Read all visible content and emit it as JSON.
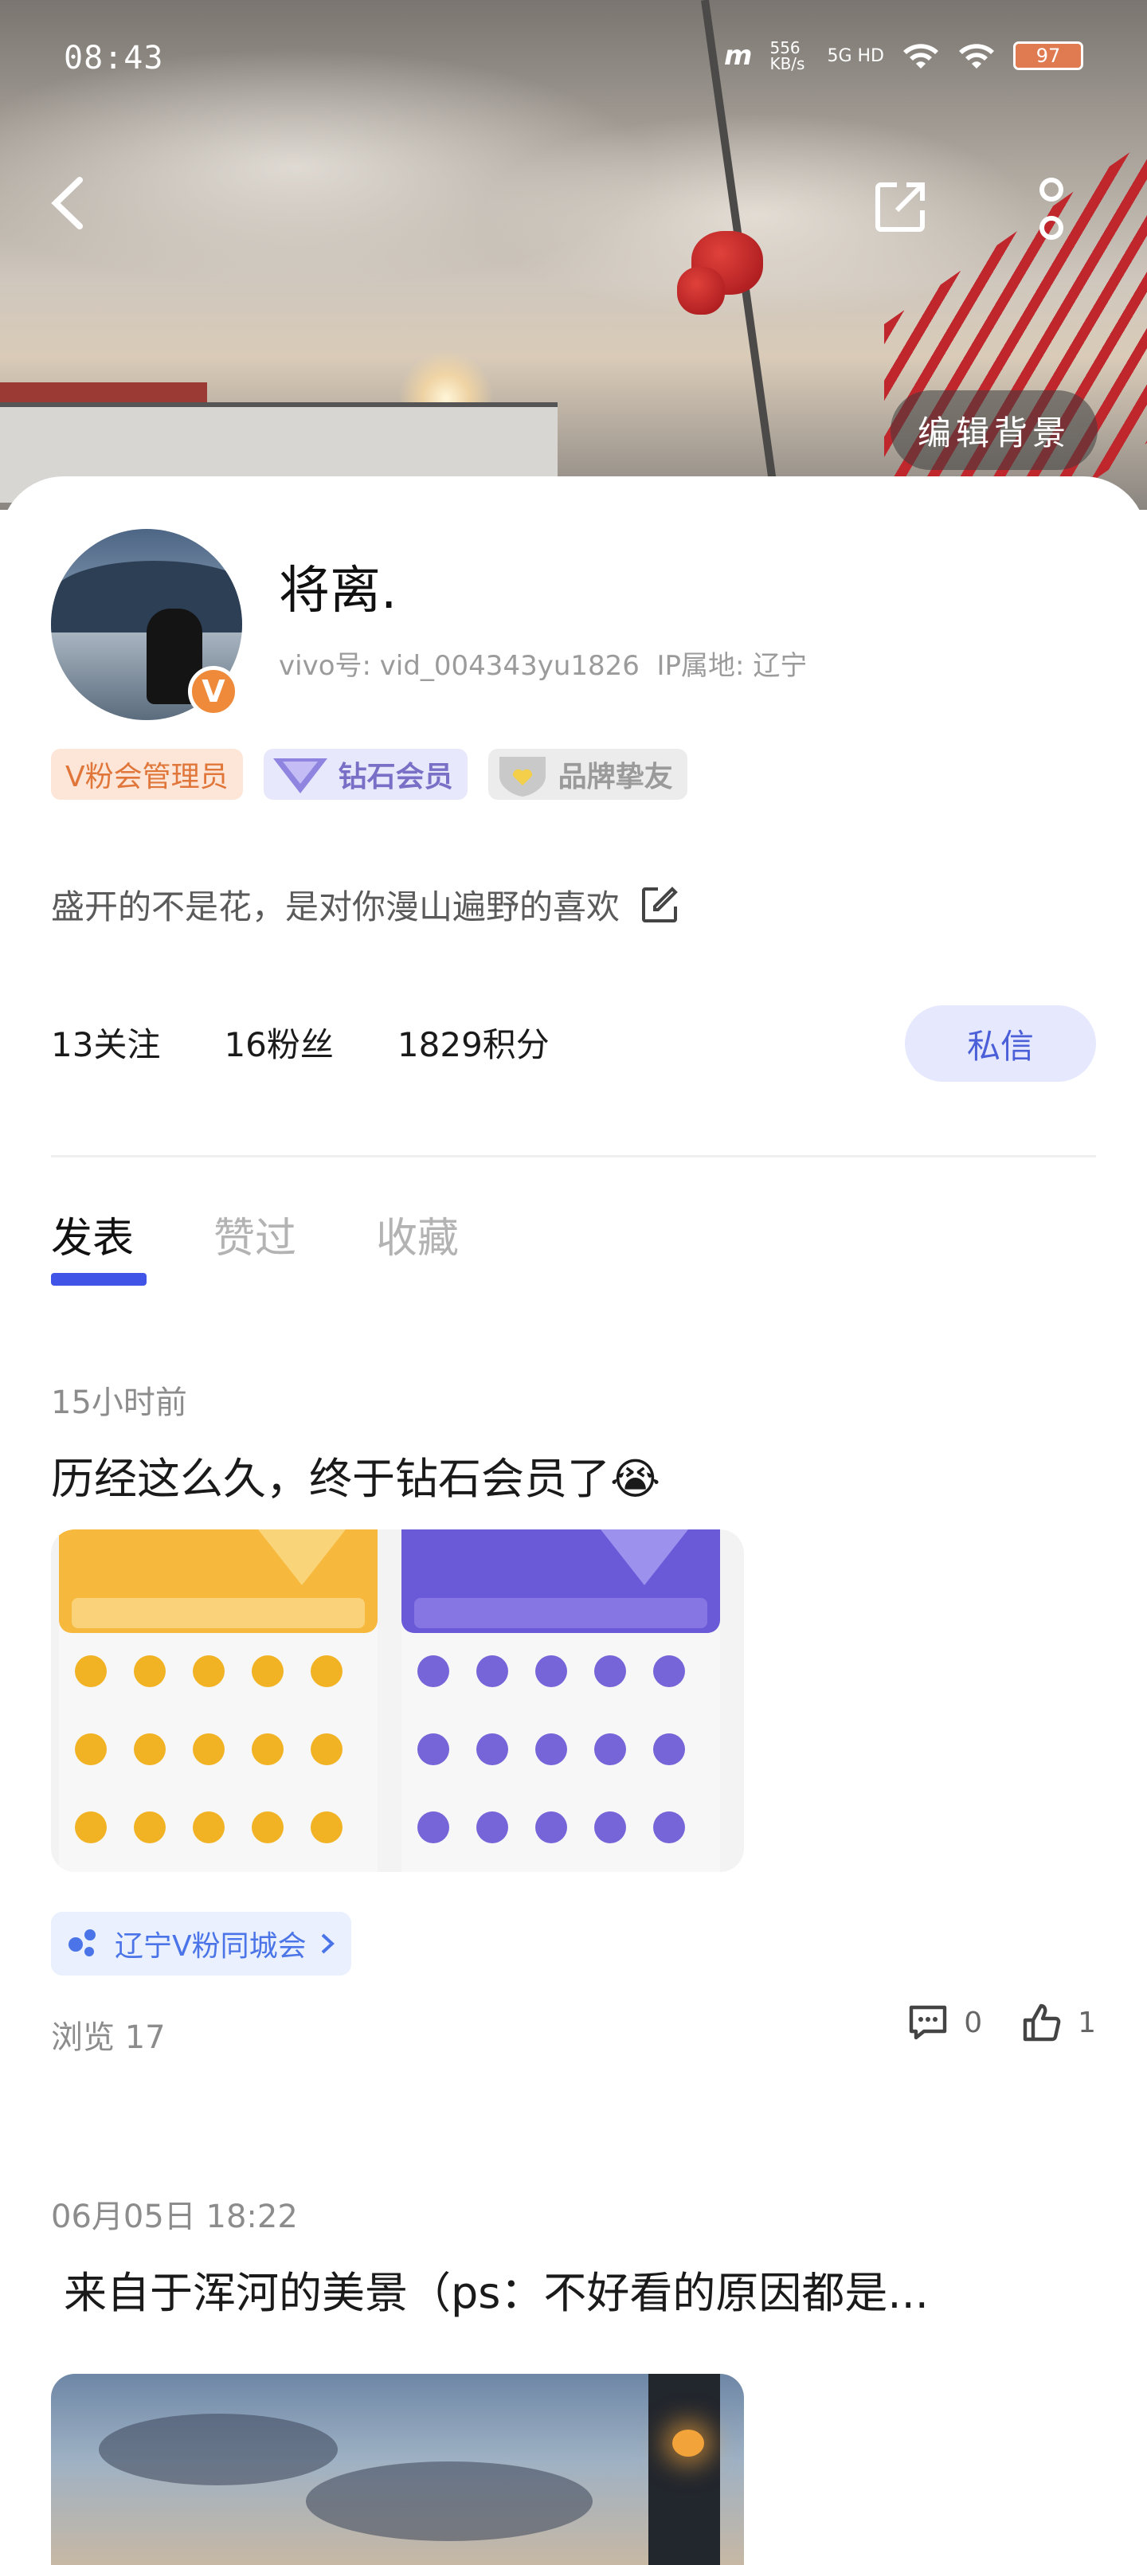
{
  "status_bar": {
    "time": "08:43",
    "net_speed": "556 KB/s",
    "network": "5G HD",
    "battery": "97"
  },
  "header": {
    "edit_background_label": "编辑背景"
  },
  "profile": {
    "username": "将离.",
    "vivo_id_label": "vivo号:",
    "vivo_id": "vid_004343yu1826",
    "ip_label": "IP属地:",
    "ip_location": "辽宁",
    "avatar_badge": "V",
    "badges": {
      "vfan": "V粉会管理员",
      "diamond": "钻石会员",
      "brand": "品牌挚友"
    },
    "signature": "盛开的不是花，是对你漫山遍野的喜欢",
    "stats": {
      "following": "13关注",
      "fans": "16粉丝",
      "points": "1829积分"
    },
    "dm_label": "私信"
  },
  "tabs": [
    "发表",
    "赞过",
    "收藏"
  ],
  "posts": [
    {
      "time": "15小时前",
      "title": "历经这么久，终于钻石会员了😭",
      "tag": "辽宁V粉同城会",
      "views": "浏览 17",
      "comments": "0",
      "likes": "1"
    },
    {
      "time": "06月05日 18:22",
      "title": "来自于浑河的美景（ps：不好看的原因都是..."
    }
  ],
  "colors": {
    "accent": "#4154e8",
    "dm_bg": "#e6e9fd",
    "vfan_badge": "#e0763a",
    "diamond_badge": "#7a6fc7"
  }
}
